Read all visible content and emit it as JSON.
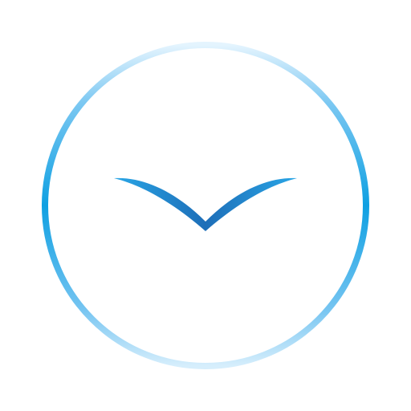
{
  "icon": {
    "name": "clock-chevron-logo",
    "colors": {
      "ring_side": "#0FA0E2",
      "ring_top": "#E4F4FE",
      "ring_bottom": "#D6EEFC",
      "chevron_light": "#2AA6E6",
      "chevron_mid": "#1F86CF",
      "chevron_dark": "#1D6EB8",
      "background": "#FFFFFF"
    }
  }
}
